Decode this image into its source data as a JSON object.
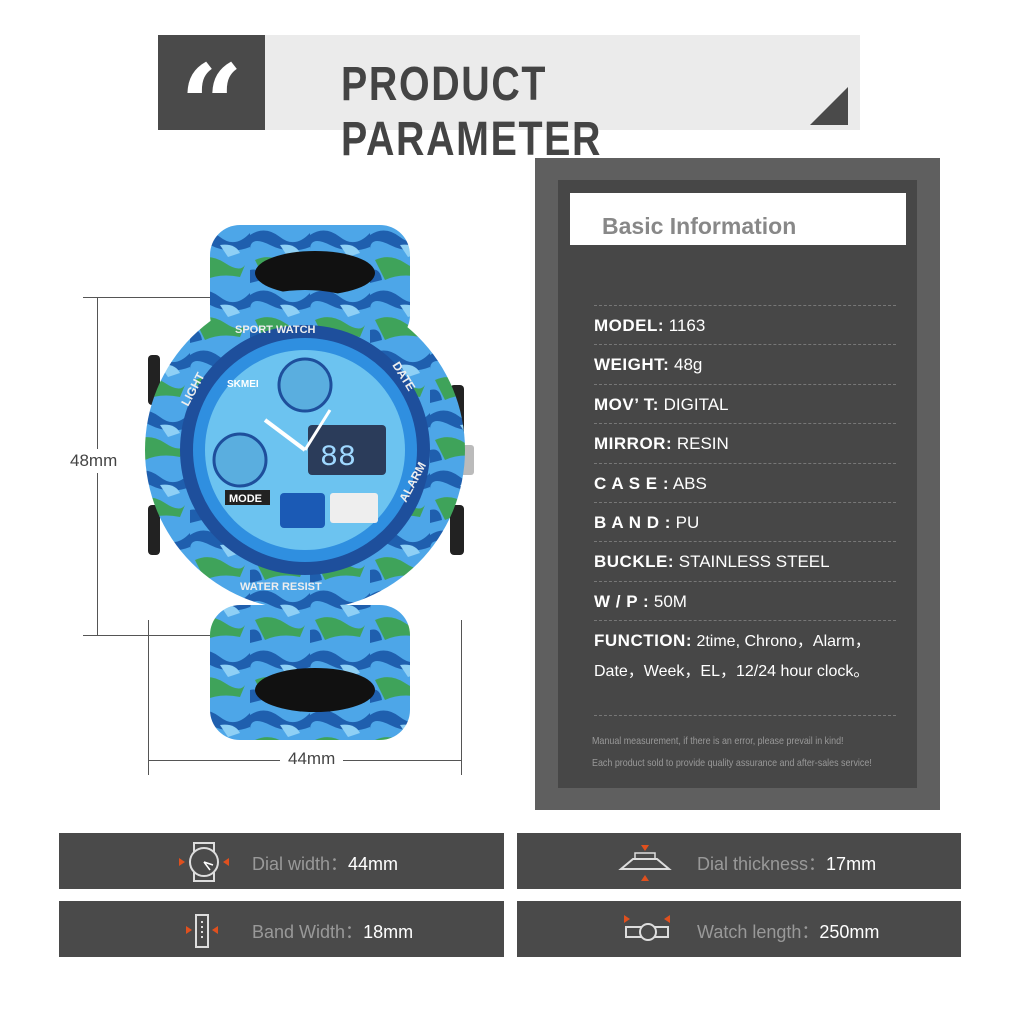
{
  "header": {
    "title": "PRODUCT PARAMETER",
    "quote_icon": "quote-icon"
  },
  "info": {
    "title": "Basic Information",
    "rows": [
      {
        "key": "MODEL:",
        "value": "1163"
      },
      {
        "key": "WEIGHT:",
        "value": "48g"
      },
      {
        "key": "MOV’ T:",
        "value": "DIGITAL"
      },
      {
        "key": "MIRROR:",
        "value": "RESIN"
      },
      {
        "key": "C A S E :",
        "value": "ABS"
      },
      {
        "key": "B A N D :",
        "value": "PU"
      },
      {
        "key": "BUCKLE:",
        "value": "STAINLESS STEEL"
      },
      {
        "key": "W / P :",
        "value": "50M"
      },
      {
        "key": "FUNCTION:",
        "value": "2time, Chrono，Alarm，",
        "value2": "Date，Week，EL，12/24 hour clock。"
      }
    ],
    "notes": [
      "Manual measurement, if there is an error, please prevail in kind!",
      "Each product sold to provide quality assurance and after-sales service!"
    ]
  },
  "dimensions": {
    "height": "48mm",
    "width": "44mm"
  },
  "specs": [
    {
      "label": "Dial width：",
      "value": "44mm",
      "icon": "dial-width-icon"
    },
    {
      "label": "Dial thickness：",
      "value": "17mm",
      "icon": "dial-thickness-icon"
    },
    {
      "label": "Band Width：",
      "value": "18mm",
      "icon": "band-width-icon"
    },
    {
      "label": "Watch length：",
      "value": "250mm",
      "icon": "watch-length-icon"
    }
  ],
  "watch": {
    "brand": "SKMEI",
    "bezel_texts": [
      "SPORT WATCH",
      "LIGHT",
      "DATE",
      "MODE",
      "ALARM",
      "WATER RESIST"
    ]
  },
  "colors": {
    "dark": "#4a4a4a",
    "accent": "#e0501e",
    "camo_blue": "#3a8fd6"
  }
}
